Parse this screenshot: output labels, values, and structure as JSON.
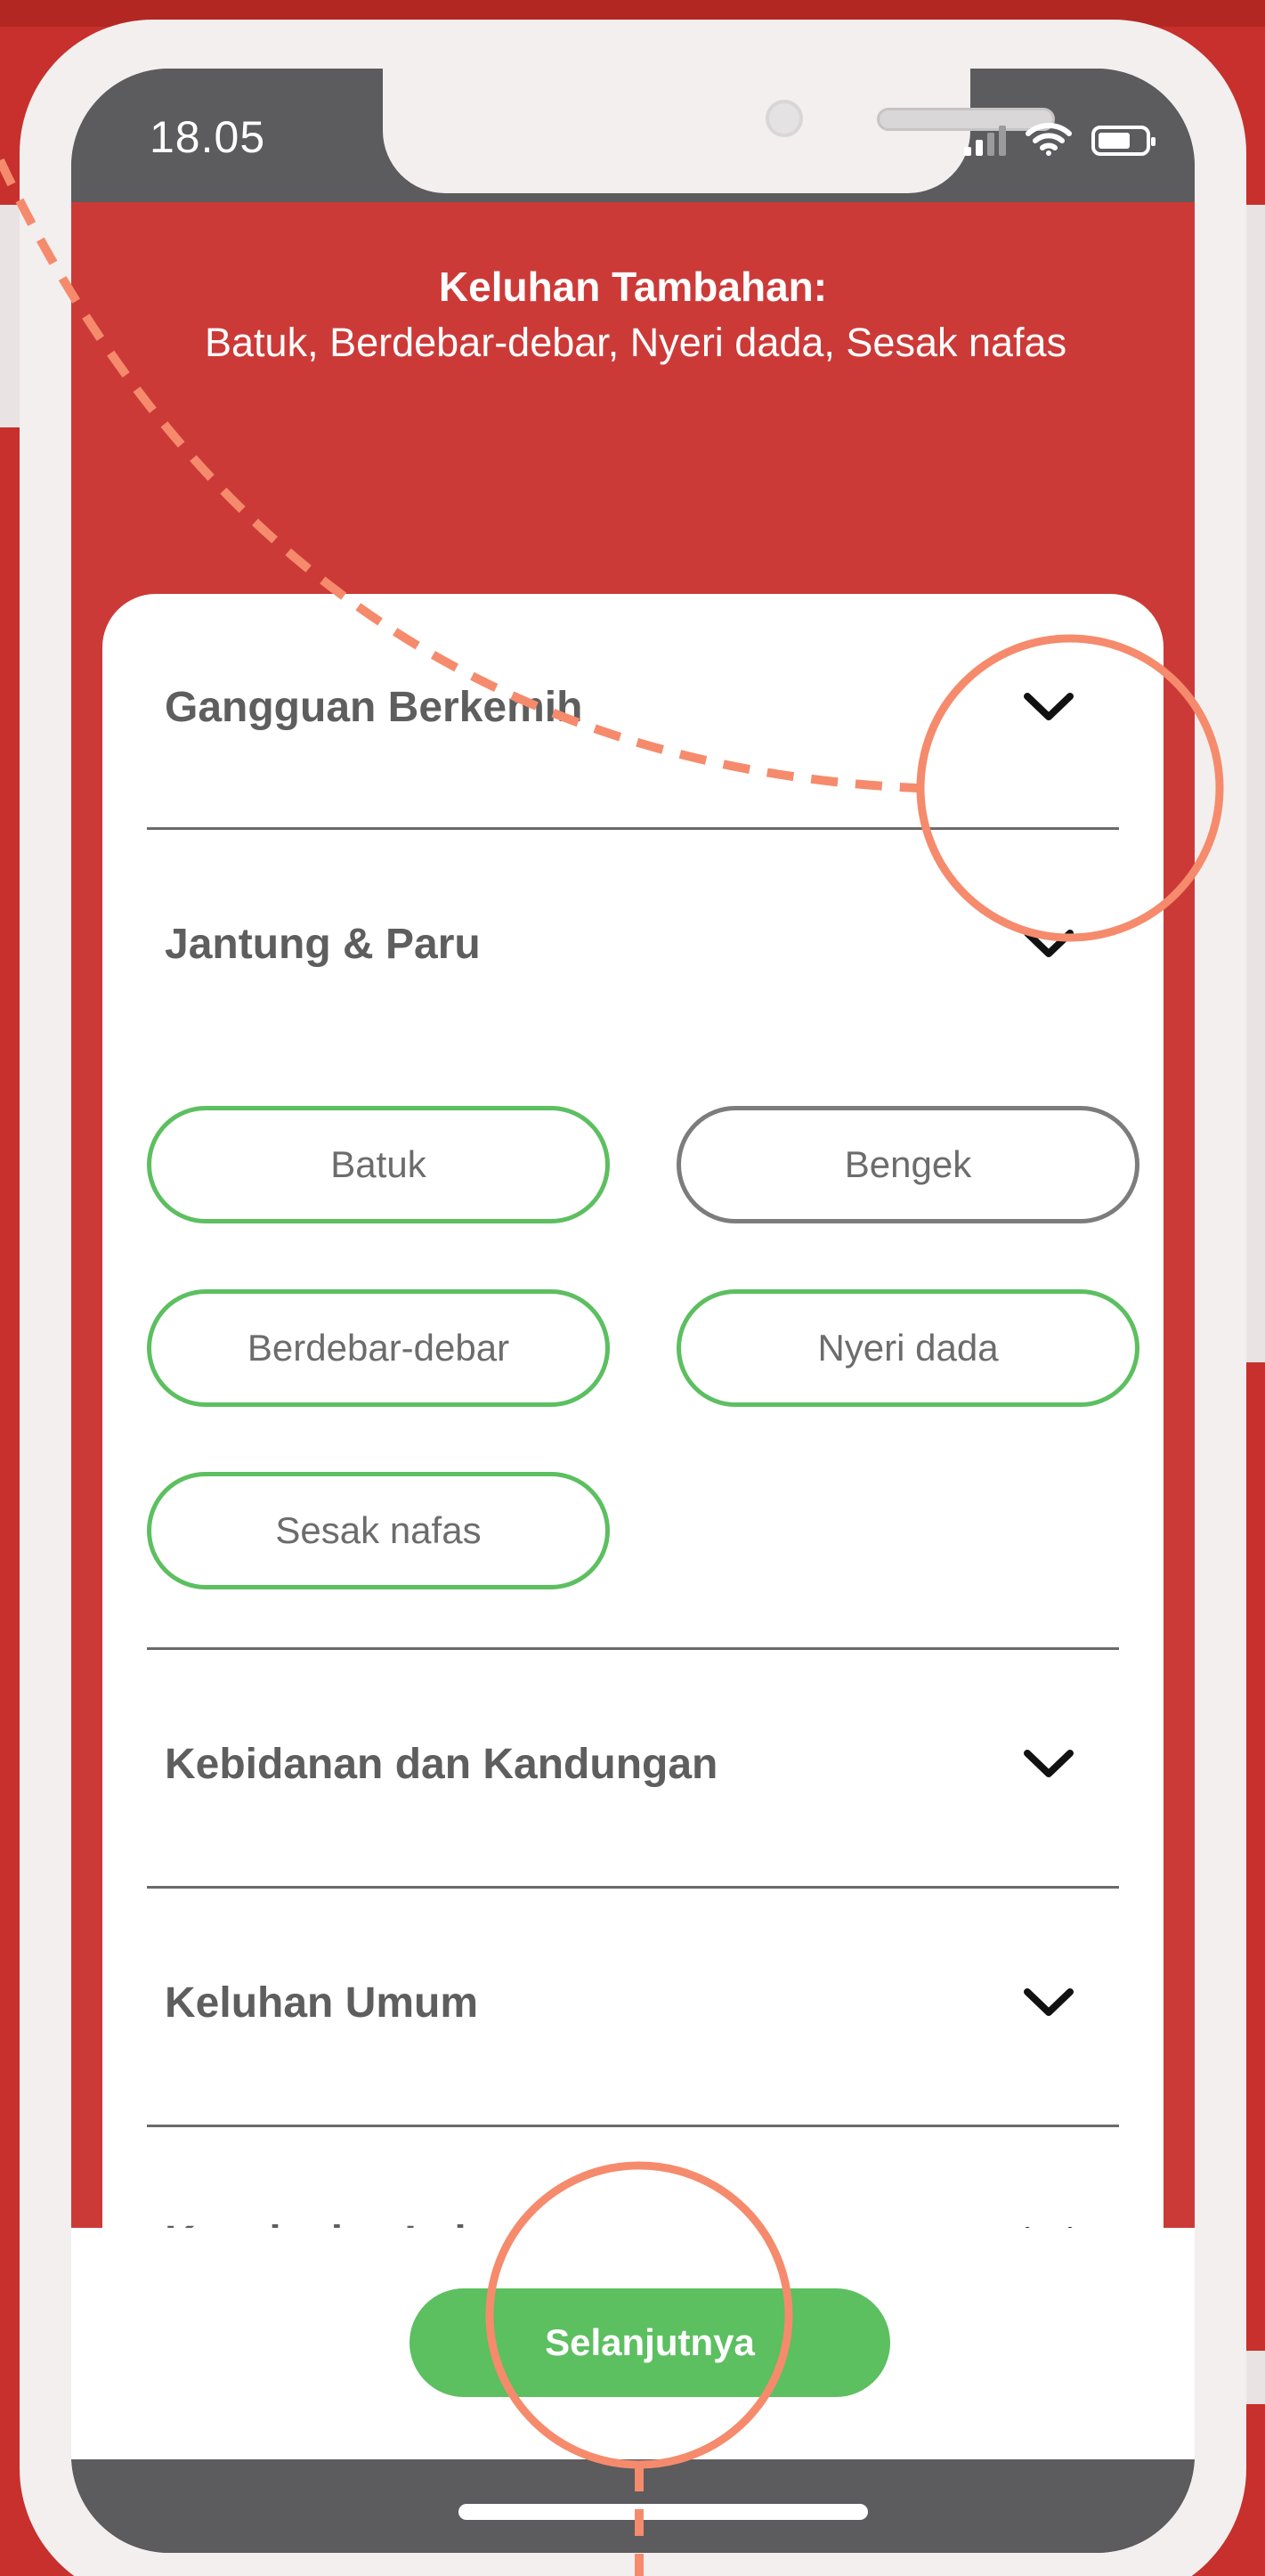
{
  "status_bar": {
    "time": "18.05"
  },
  "header": {
    "complaint_title": "Keluhan Tambahan:",
    "complaint_text": "Batuk, Berdebar-debar, Nyeri dada, Sesak nafas"
  },
  "sections": [
    {
      "title": "Gangguan Berkemih",
      "expanded": false
    },
    {
      "title": "Jantung & Paru",
      "expanded": true
    },
    {
      "title": "Kebidanan dan Kandungan",
      "expanded": false
    },
    {
      "title": "Keluhan Umum",
      "expanded": false
    },
    {
      "title": "Kepala dan Leher",
      "expanded": false
    }
  ],
  "chips": [
    {
      "label": "Batuk",
      "selected": true
    },
    {
      "label": "Bengek",
      "selected": false
    },
    {
      "label": "Berdebar-debar",
      "selected": true
    },
    {
      "label": "Nyeri dada",
      "selected": true
    },
    {
      "label": "Sesak nafas",
      "selected": true
    }
  ],
  "action": {
    "next_label": "Selanjutnya"
  },
  "colors": {
    "brand_red": "#cc3a38",
    "accent_green": "#5cbf60",
    "annotation": "#f58b6c"
  },
  "icons": {
    "section_toggle": "chevron-down-icon",
    "signal": "signal-icon",
    "wifi": "wifi-icon",
    "battery": "battery-icon"
  }
}
